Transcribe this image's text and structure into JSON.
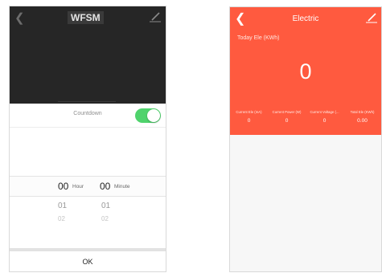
{
  "timer_screen": {
    "title": "WFSM",
    "back_icon": "chevron-left-icon",
    "edit_icon": "pencil-icon",
    "countdown_label": "Countdown",
    "countdown_enabled": true,
    "toggle_color": "#4fd36c",
    "picker": {
      "hour_value": "00",
      "hour_unit": "Hour",
      "minute_value": "00",
      "minute_unit": "Minute",
      "hour_next": "01",
      "hour_next2": "02",
      "minute_next": "01",
      "minute_next2": "02"
    },
    "ok_label": "OK"
  },
  "electric_screen": {
    "title": "Electric",
    "back_icon": "chevron-left-icon",
    "edit_icon": "pencil-icon",
    "accent_color": "#ff5a3f",
    "today_label": "Today Ele (KWh)",
    "today_value": "0",
    "stats": [
      {
        "label": "Current Ele (mA)",
        "value": "0"
      },
      {
        "label": "Current Power (W)",
        "value": "0"
      },
      {
        "label": "Current Voltage (...",
        "value": "0"
      },
      {
        "label": "Total Ele (KWh)",
        "value": "0.00"
      }
    ]
  }
}
